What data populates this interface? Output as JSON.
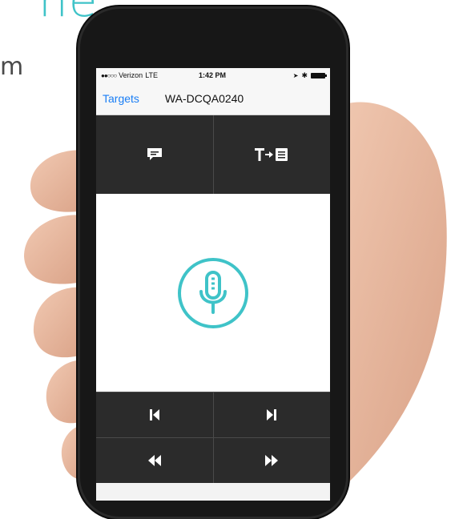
{
  "background": {
    "headline_fragment": "ne",
    "subtext_fragment": "m"
  },
  "status_bar": {
    "carrier": "Verizon",
    "network": "LTE",
    "time": "1:42 PM"
  },
  "nav_bar": {
    "back_label": "Targets",
    "title": "WA-DCQA0240"
  },
  "top_buttons": [
    {
      "name": "comment",
      "icon": "speech-bubble-icon"
    },
    {
      "name": "text-to-document",
      "icon": "text-to-list-icon"
    }
  ],
  "mic": {
    "icon": "microphone-icon",
    "color": "#3fc3c8"
  },
  "bottom_buttons": [
    {
      "name": "skip-previous",
      "icon": "skip-previous-icon"
    },
    {
      "name": "skip-next",
      "icon": "skip-next-icon"
    },
    {
      "name": "rewind",
      "icon": "rewind-icon"
    },
    {
      "name": "fast-forward",
      "icon": "fast-forward-icon"
    }
  ],
  "colors": {
    "accent": "#3fc3c8",
    "ios_blue": "#1a7ef5",
    "panel_dark": "#2b2b2b"
  }
}
